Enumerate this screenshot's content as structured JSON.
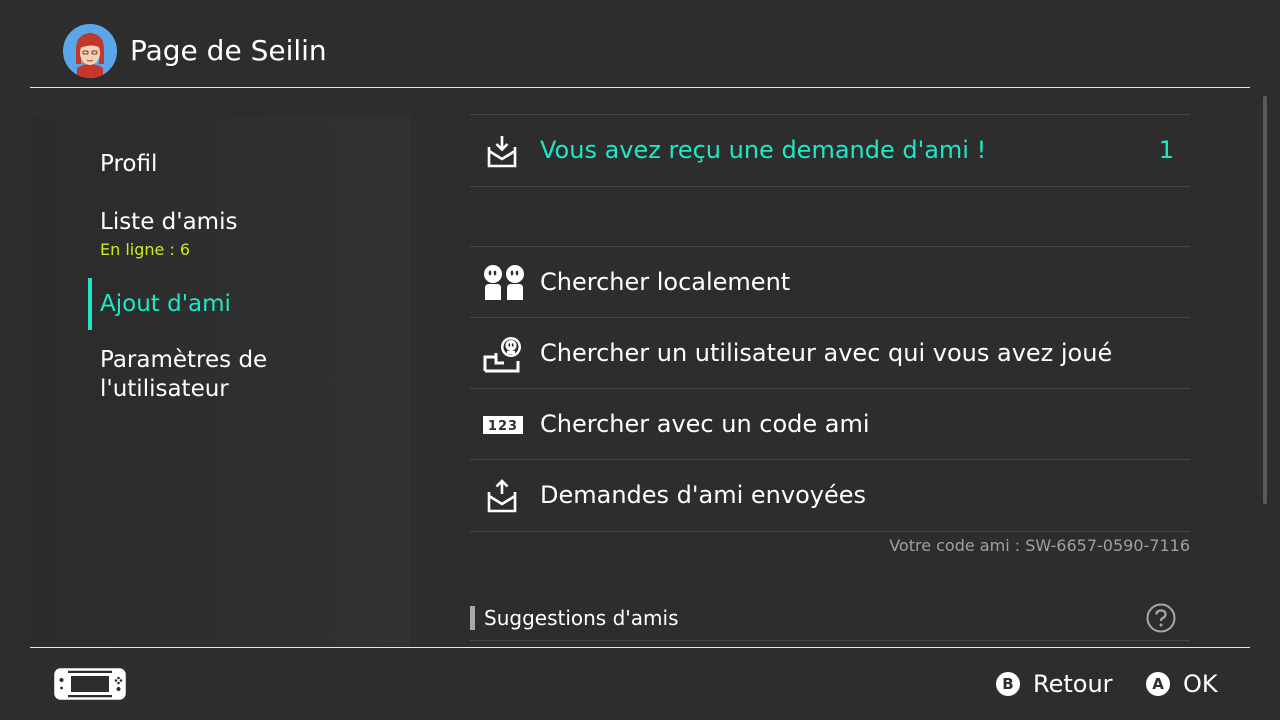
{
  "header": {
    "title": "Page de Seilin"
  },
  "sidebar": {
    "items": [
      {
        "label": "Profil"
      },
      {
        "label": "Liste d'amis",
        "sub": "En ligne : 6"
      },
      {
        "label": "Ajout d'ami",
        "active": true
      },
      {
        "label_line1": "Paramètres de",
        "label_line2": "l'utilisateur"
      }
    ]
  },
  "main": {
    "request": {
      "label": "Vous avez reçu une demande d'ami !",
      "count": "1",
      "icon": "inbox-download-icon"
    },
    "options": [
      {
        "label": "Chercher localement",
        "icon": "local-users-icon"
      },
      {
        "label": "Chercher un utilisateur avec qui vous avez joué",
        "icon": "played-with-user-icon"
      },
      {
        "label": "Chercher avec un code ami",
        "icon": "friend-code-icon"
      },
      {
        "label": "Demandes d'ami envoyées",
        "icon": "outbox-upload-icon"
      }
    ],
    "friend_code": "Votre code ami : SW-6657-0590-7116",
    "suggestions_title": "Suggestions d'amis"
  },
  "footer": {
    "back_key": "B",
    "back_label": "Retour",
    "ok_key": "A",
    "ok_label": "OK"
  },
  "colors": {
    "background": "#2d2d2d",
    "accent": "#1ee8c8",
    "online": "#c6f01c"
  }
}
